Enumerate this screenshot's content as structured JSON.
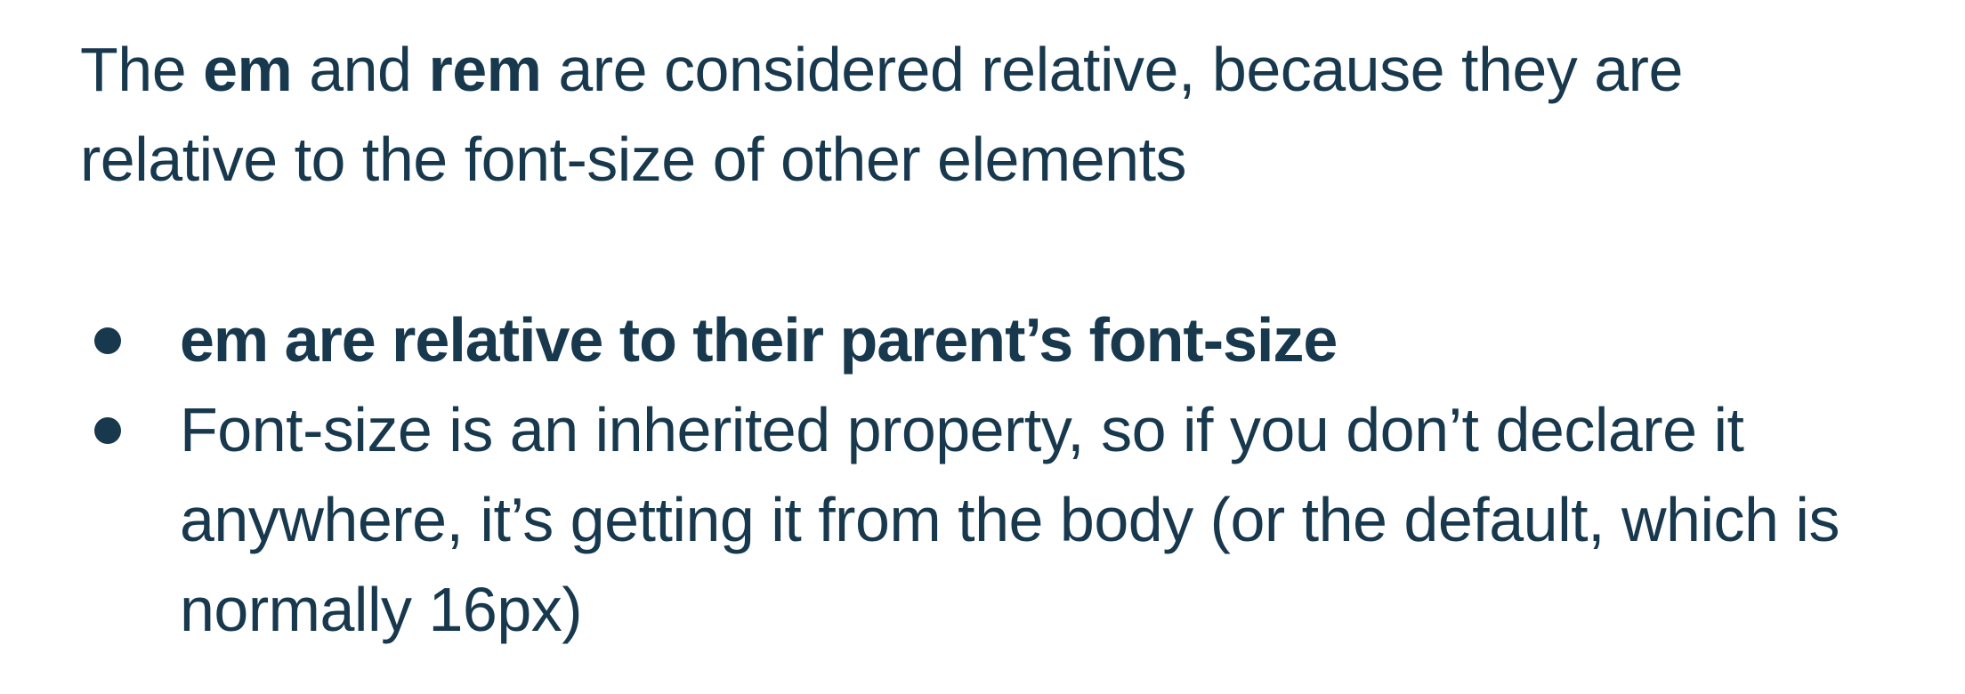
{
  "intro": {
    "pre": "The ",
    "term1": "em",
    "mid": " and ",
    "term2": "rem",
    "post": " are considered relative, because they are relative to the font-size of other elements"
  },
  "bullets": [
    {
      "text": "em are relative to their parent’s font-size"
    },
    {
      "text": "Font-size is an inherited property, so if you don’t declare it anywhere, it’s getting it from the body (or the default, which is normally 16px)"
    }
  ],
  "colors": {
    "text": "#17384d",
    "background": "#ffffff"
  }
}
